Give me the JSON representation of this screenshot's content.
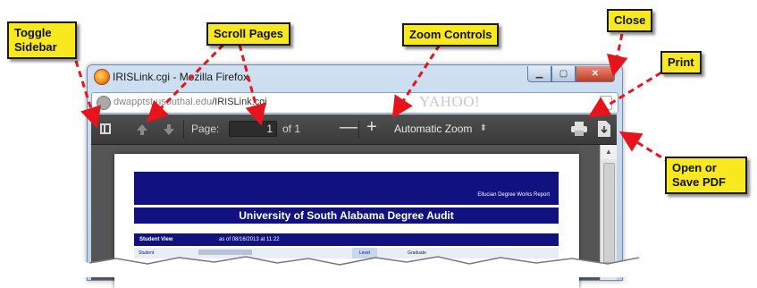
{
  "window": {
    "title": "IRISLink.cgi - Mozilla Firefox",
    "url_host": "dwapptst.usouthal.edu",
    "url_path": "/IRISLink.cgi",
    "search_brand": "YAHOO!"
  },
  "toolbar": {
    "page_label": "Page:",
    "page_value": "1",
    "page_of": "of 1",
    "zoom_out_label": "—",
    "zoom_in_label": "+",
    "zoom_value": "Automatic Zoom"
  },
  "document": {
    "report_name": "Ellucian Degree Works Report",
    "title": "University of South Alabama Degree Audit",
    "view_label": "Student View",
    "as_of": "as of 08/16/2013 at 11:22",
    "student_label": "Student",
    "level_label": "Level",
    "level_value": "Graduate"
  },
  "callouts": {
    "toggle_sidebar": "Toggle\nSidebar",
    "scroll_pages": "Scroll Pages",
    "zoom_controls": "Zoom Controls",
    "close": "Close",
    "print": "Print",
    "open_save": "Open or\nSave PDF"
  },
  "colors": {
    "callout_bg": "#f8e81f",
    "arrow": "#e8141b",
    "doc_blue": "#11117f"
  }
}
